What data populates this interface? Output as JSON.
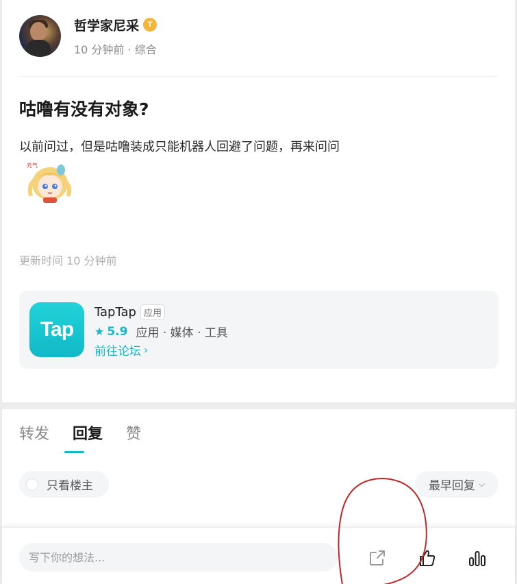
{
  "post": {
    "author_name": "哲学家尼采",
    "badge_letter": "T",
    "author_meta": "10 分钟前 · 综合",
    "title": "咕噜有没有对象?",
    "body": "以前问过，但是咕噜装成只能机器人回避了问题，再来问问",
    "updated": "更新时间 10 分钟前"
  },
  "app_card": {
    "logo_text": "Tap",
    "name": "TapTap",
    "tag": "应用",
    "rating": "5.9",
    "categories": "应用 · 媒体 · 工具",
    "forum_link": "前往论坛",
    "accent_color": "#16b8c5"
  },
  "tabs": [
    {
      "label": "转发",
      "active": false
    },
    {
      "label": "回复",
      "active": true
    },
    {
      "label": "赞",
      "active": false
    }
  ],
  "filters": {
    "only_author": "只看楼主",
    "sort": "最早回复"
  },
  "bottom_bar": {
    "input_placeholder": "写下你的想法..."
  }
}
